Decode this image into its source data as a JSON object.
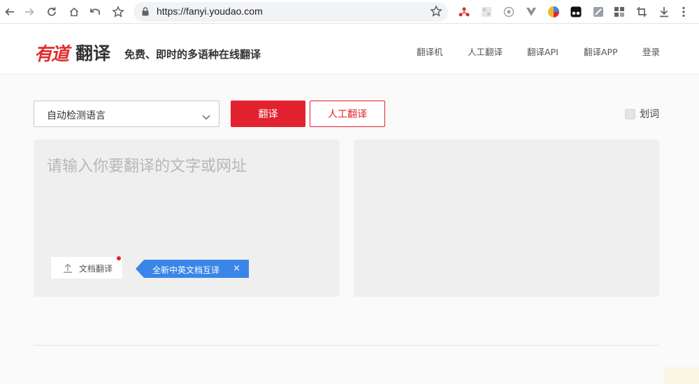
{
  "browser": {
    "url": "https://fanyi.youdao.com",
    "icons": [
      "back-icon",
      "forward-icon",
      "reload-icon",
      "home-icon",
      "history-icon",
      "bookmark-star-icon",
      "lock-icon"
    ]
  },
  "header": {
    "logo_mark": "有道",
    "logo_word": "翻译",
    "slogan": "免费、即时的多语种在线翻译",
    "nav": [
      {
        "label": "翻译机"
      },
      {
        "label": "人工翻译"
      },
      {
        "label": "翻译API"
      },
      {
        "label": "翻译APP"
      },
      {
        "label": "登录"
      }
    ]
  },
  "toolbar": {
    "language_select": "自动检测语言",
    "translate_label": "翻译",
    "human_translate_label": "人工翻译",
    "huaci_label": "划词"
  },
  "input": {
    "placeholder": "请输入你要翻译的文字或网址",
    "doc_button_label": "文档翻译",
    "promo_text": "全新中英文档互译",
    "promo_close": "×"
  },
  "colors": {
    "brand_red": "#e2232f",
    "promo_blue": "#3a86e8"
  }
}
